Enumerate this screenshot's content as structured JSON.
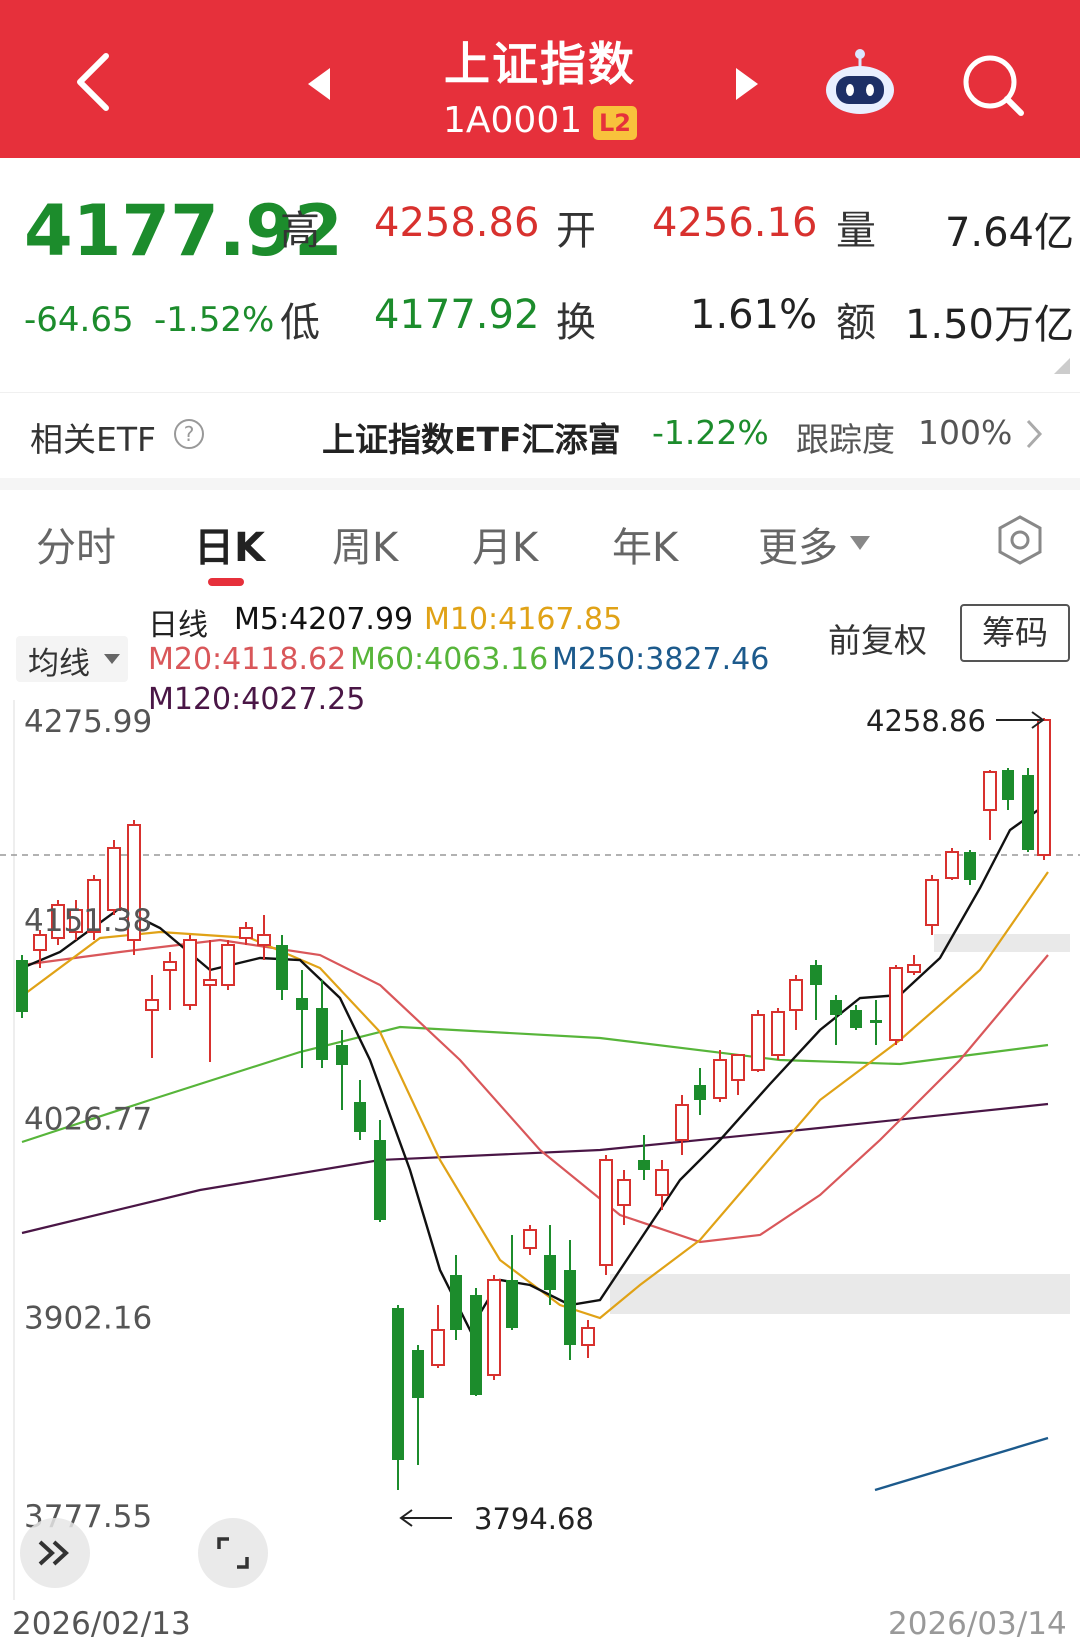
{
  "header": {
    "title": "上证指数",
    "code": "1A0001",
    "badge": "L2",
    "icons": [
      "back-arrow-icon",
      "prev-triangle-icon",
      "next-triangle-icon",
      "robot-assistant-icon",
      "search-icon"
    ]
  },
  "quote": {
    "price": "4177.92",
    "change": "-64.65",
    "change_pct": "-1.52%",
    "high_label": "高",
    "high": "4258.86",
    "low_label": "低",
    "low": "4177.92",
    "open_label": "开",
    "open": "4256.16",
    "turnover_label": "换",
    "turnover": "1.61%",
    "volume_label": "量",
    "volume": "7.64亿",
    "amount_label": "额",
    "amount": "1.50万亿"
  },
  "etf": {
    "label": "相关ETF",
    "name": "上证指数ETF汇添富",
    "change": "-1.22%",
    "tracking_label": "跟踪度",
    "tracking": "100%"
  },
  "tabs": [
    "分时",
    "日K",
    "周K",
    "月K",
    "年K",
    "更多"
  ],
  "active_tab": "日K",
  "indicator": {
    "ma_toggle": "均线",
    "line_type": "日线",
    "m5": "M5:4207.99",
    "m10": "M10:4167.85",
    "m20": "M20:4118.62",
    "m60": "M60:4063.16",
    "m250": "M250:3827.46",
    "m120": "M120:4027.25",
    "adjust": "前复权",
    "chips_button": "筹码"
  },
  "colors": {
    "header": "#e6303b",
    "up": "#d8312e",
    "down": "#1c8c2c",
    "m5": "#111111",
    "m10": "#e0a216",
    "m20": "#d9575a",
    "m60": "#57b53a",
    "m120": "#4a1646",
    "m250": "#1c5a8c"
  },
  "chart_data": {
    "type": "candlestick",
    "y_ticks": [
      "4275.99",
      "4151.38",
      "4026.77",
      "3902.16",
      "3777.55"
    ],
    "ylim": [
      3777.55,
      4275.99
    ],
    "high_marker": "4258.86",
    "low_marker": "3794.68",
    "start_date": "2026/02/13",
    "end_date": "2026/03/14"
  }
}
